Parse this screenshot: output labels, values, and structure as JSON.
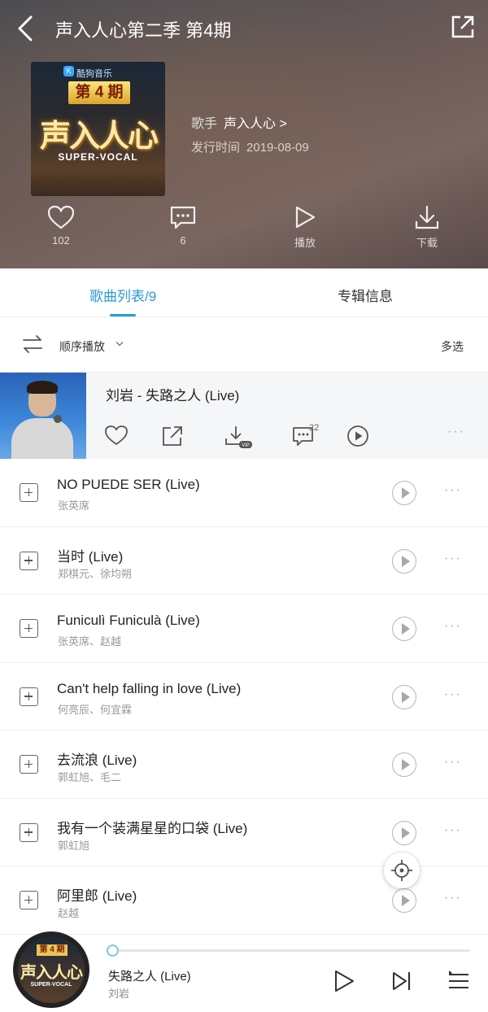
{
  "header": {
    "title": "声入人心第二季 第4期",
    "cover": {
      "brand": "酷狗音乐",
      "episode": "第 4 期",
      "show": "声入人心",
      "subtitle": "SUPER-VOCAL"
    },
    "singer_label": "歌手",
    "singer_value": "声入人心 >",
    "release_label": "发行时间",
    "release_value": "2019-08-09",
    "actions": [
      {
        "icon": "heart-icon",
        "label": "102"
      },
      {
        "icon": "comment-icon",
        "label": "6"
      },
      {
        "icon": "play-icon",
        "label": "播放"
      },
      {
        "icon": "download-icon",
        "label": "下载"
      }
    ]
  },
  "tabs": {
    "songs": "歌曲列表/9",
    "info": "专辑信息"
  },
  "modebar": {
    "mode": "顺序播放",
    "multi_select": "多选"
  },
  "current_song": {
    "title": "刘岩 - 失路之人 (Live)",
    "comment_count": "22"
  },
  "songs": [
    {
      "title": "NO PUEDE SER (Live)",
      "artist": "张英席"
    },
    {
      "title": "当时 (Live)",
      "artist": "郑棋元、徐均朔"
    },
    {
      "title": "Funiculì Funiculà (Live)",
      "artist": "张英席、赵越"
    },
    {
      "title": "Can't help falling in love (Live)",
      "artist": "何亮辰、何宜霖"
    },
    {
      "title": "去流浪 (Live)",
      "artist": "郭虹旭、毛二"
    },
    {
      "title": "我有一个装满星星的口袋 (Live)",
      "artist": "郭虹旭"
    },
    {
      "title": "阿里郎 (Live)",
      "artist": "赵越"
    }
  ],
  "player": {
    "title": "失路之人 (Live)",
    "artist": "刘岩",
    "progress": 0
  },
  "colors": {
    "accent": "#2a9bd8",
    "header_bg": "#5e5352"
  }
}
